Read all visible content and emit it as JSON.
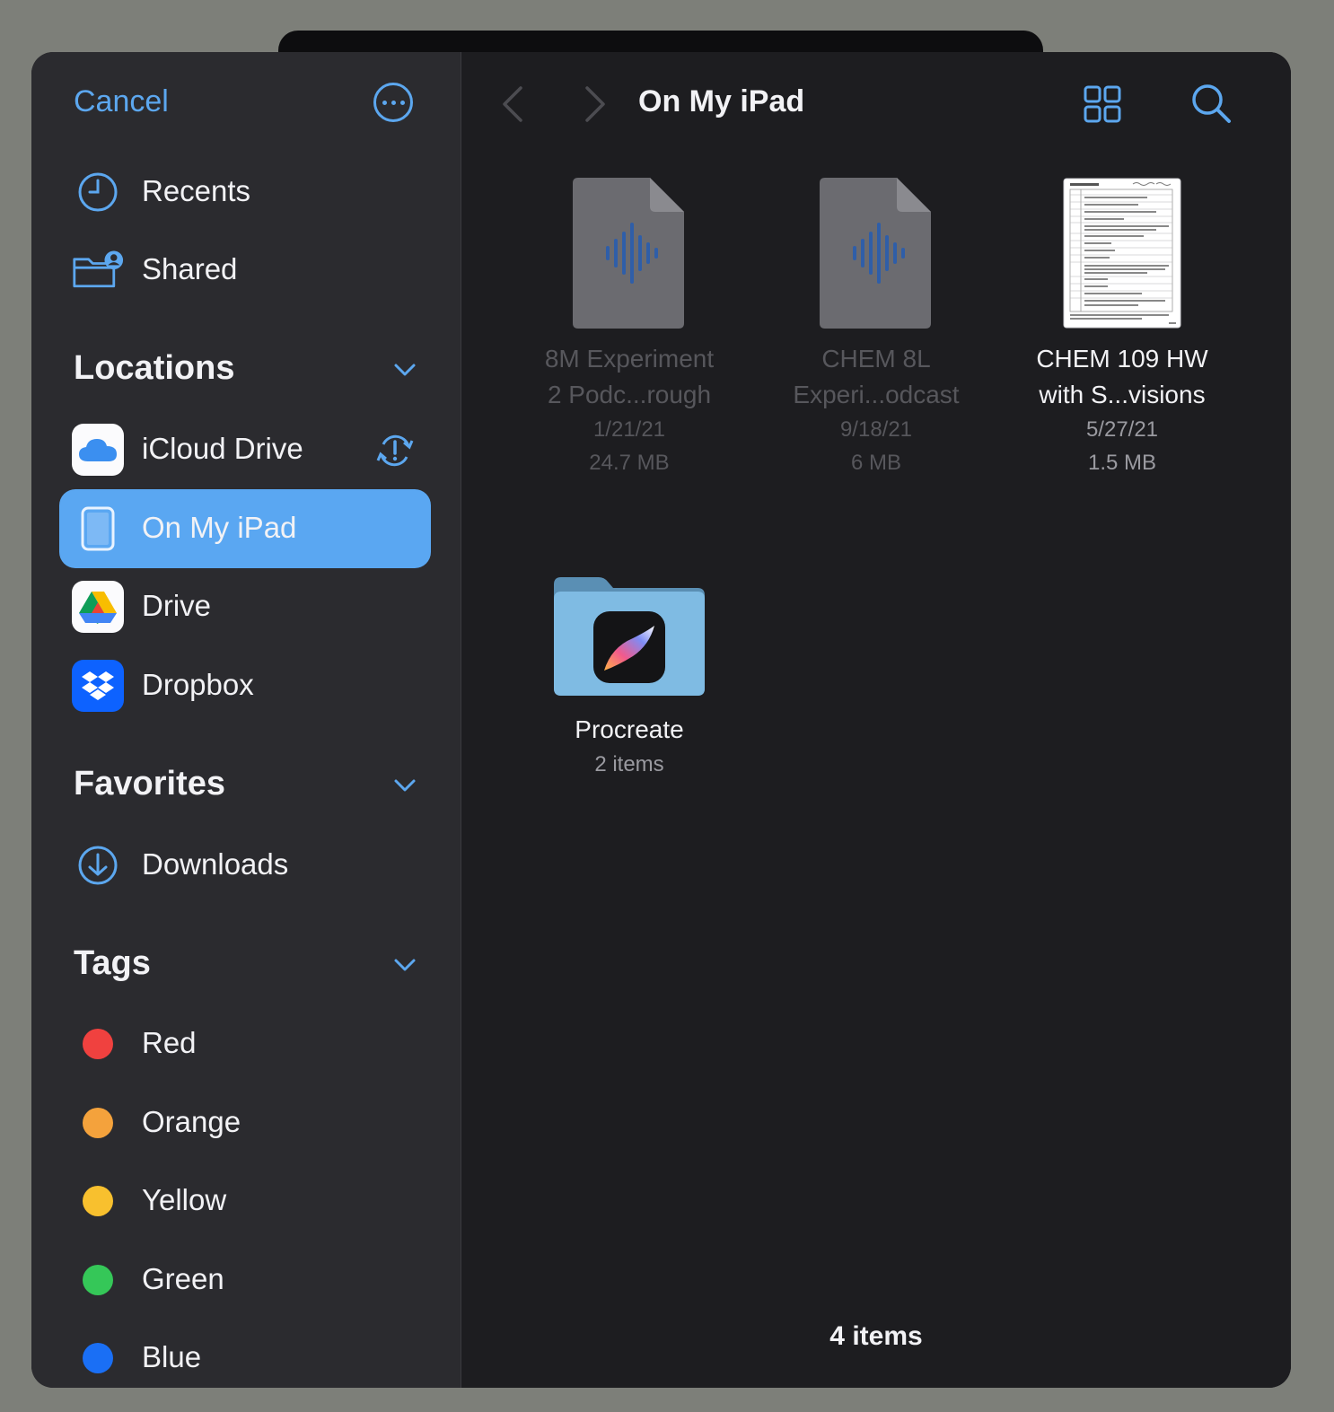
{
  "sidebar": {
    "cancel_label": "Cancel",
    "recents_label": "Recents",
    "shared_label": "Shared",
    "locations_title": "Locations",
    "locations": [
      {
        "label": "iCloud Drive"
      },
      {
        "label": "On My iPad",
        "selected": true
      },
      {
        "label": "Drive"
      },
      {
        "label": "Dropbox"
      }
    ],
    "favorites_title": "Favorites",
    "favorites": [
      {
        "label": "Downloads"
      }
    ],
    "tags_title": "Tags",
    "tags": [
      {
        "label": "Red",
        "color": "#f0413f"
      },
      {
        "label": "Orange",
        "color": "#f4a23c"
      },
      {
        "label": "Yellow",
        "color": "#f8c02e"
      },
      {
        "label": "Green",
        "color": "#35c758"
      },
      {
        "label": "Blue",
        "color": "#1a6ff5"
      }
    ]
  },
  "toolbar": {
    "title": "On My iPad"
  },
  "files": [
    {
      "name_line1": "8M Experiment",
      "name_line2": "2 Podc...rough",
      "date": "1/21/21",
      "size": "24.7 MB",
      "type": "audio"
    },
    {
      "name_line1": "CHEM 8L",
      "name_line2": "Experi...odcast",
      "date": "9/18/21",
      "size": "6 MB",
      "type": "audio"
    },
    {
      "name_line1": "CHEM 109 HW",
      "name_line2": "with S...visions",
      "date": "5/27/21",
      "size": "1.5 MB",
      "type": "document"
    },
    {
      "name_line1": "Procreate",
      "count": "2 items",
      "type": "folder"
    }
  ],
  "footer": {
    "count_label": "4 items"
  },
  "colors": {
    "accent": "#5ca7ef",
    "selected_row": "#5aa7f2",
    "sidebar_bg": "#2b2b2f",
    "main_bg": "#1d1d20"
  }
}
